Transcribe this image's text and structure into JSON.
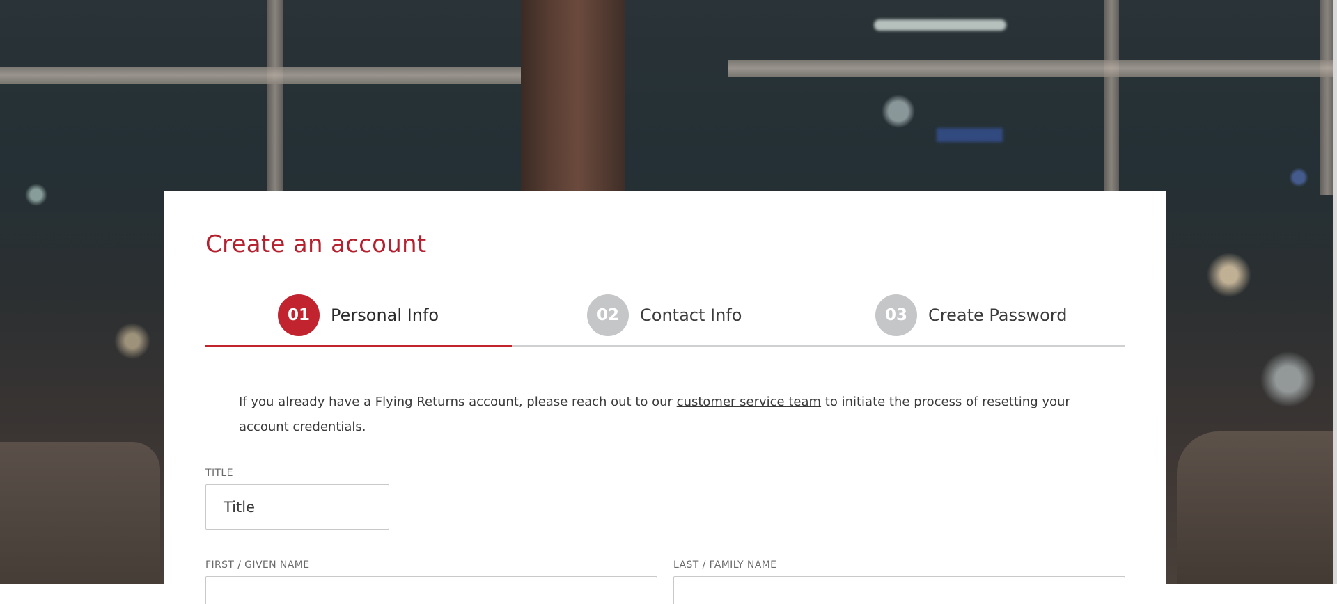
{
  "form": {
    "title": "Create an account",
    "steps": [
      {
        "number": "01",
        "label": "Personal Info",
        "active": true
      },
      {
        "number": "02",
        "label": "Contact Info",
        "active": false
      },
      {
        "number": "03",
        "label": "Create Password",
        "active": false
      }
    ],
    "progress_fraction": 0.333,
    "notice": {
      "before": "If you already have a Flying Returns account, please reach out to our ",
      "link": "customer service team",
      "after": " to initiate the process of resetting your account credentials."
    },
    "fields": {
      "title_label": "TITLE",
      "title_value": "Title",
      "first_name_label": "FIRST / GIVEN NAME",
      "last_name_label": "LAST / FAMILY NAME"
    }
  },
  "colors": {
    "accent": "#c1242f",
    "title_red": "#b5202f",
    "inactive_step": "#c4c6c8"
  }
}
